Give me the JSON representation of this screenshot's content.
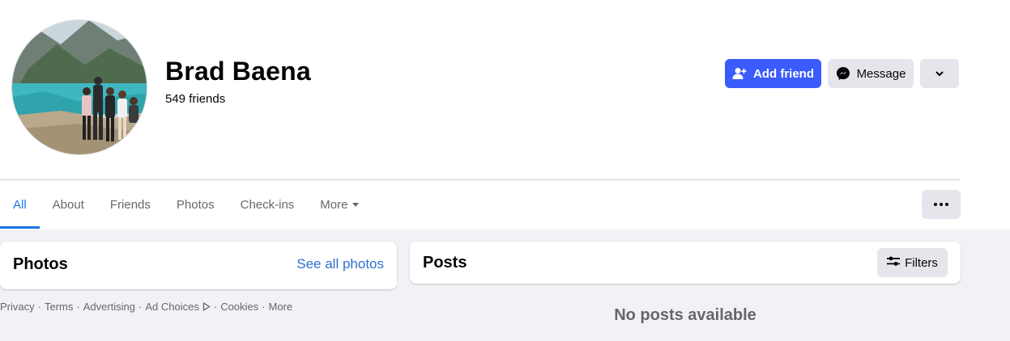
{
  "profile": {
    "name": "Brad Baena",
    "friends_count": "549 friends"
  },
  "actions": {
    "add_friend": "Add friend",
    "message": "Message"
  },
  "tabs": [
    {
      "label": "All",
      "active": true
    },
    {
      "label": "About",
      "active": false
    },
    {
      "label": "Friends",
      "active": false
    },
    {
      "label": "Photos",
      "active": false
    },
    {
      "label": "Check-ins",
      "active": false
    },
    {
      "label": "More",
      "active": false
    }
  ],
  "photos_card": {
    "title": "Photos",
    "see_all": "See all photos"
  },
  "posts_card": {
    "title": "Posts",
    "filters_label": "Filters",
    "empty_message": "No posts available"
  },
  "footer": {
    "links": [
      "Privacy",
      "Terms",
      "Advertising",
      "Ad Choices",
      "Cookies",
      "More"
    ],
    "separator": "·"
  },
  "colors": {
    "accent": "#1b74e4",
    "primary_button": "#3b5bfd",
    "secondary_button": "#e4e6eb",
    "page_bg": "#f0f2f5"
  },
  "icons": {
    "add_friend": "person-plus-icon",
    "message": "messenger-icon",
    "dropdown": "chevron-down-icon",
    "more_options": "ellipsis-icon",
    "filters": "sliders-icon",
    "ad_choices": "ad-choices-icon"
  }
}
